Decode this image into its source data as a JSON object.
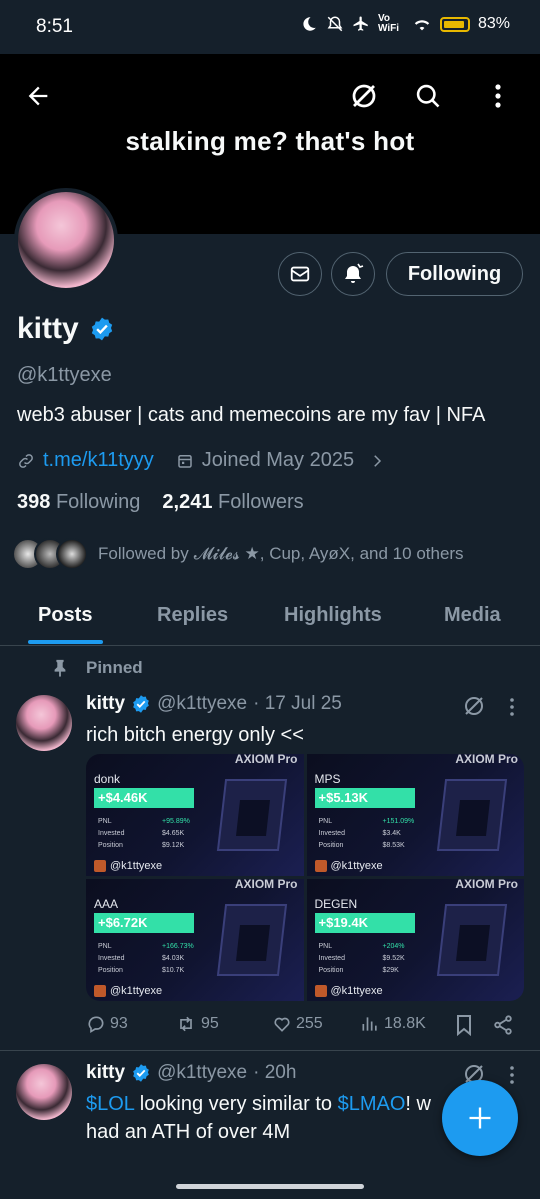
{
  "status_bar": {
    "time": "8:51",
    "net_label": "Vo WiFi",
    "battery": "83%"
  },
  "header": {
    "banner_text": "stalking me? that's hot"
  },
  "profile": {
    "name": "kitty",
    "handle": "@k1ttyexe",
    "bio": "web3 abuser | cats and memecoins are my fav | NFA",
    "link": "t.me/k11tyyy",
    "joined": "Joined May 2025",
    "following_count": "398",
    "following_label": "Following",
    "followers_count": "2,241",
    "followers_label": "Followers",
    "followed_by_prefix": "Followed by",
    "followed_by_names": "𝓜𝓲𝓵𝓮𝓼 ★, Cup, AyøX, and 10 others",
    "follow_button": "Following"
  },
  "tabs": [
    {
      "label": "Posts"
    },
    {
      "label": "Replies"
    },
    {
      "label": "Highlights"
    },
    {
      "label": "Media"
    }
  ],
  "posts": [
    {
      "pinned_label": "Pinned",
      "name": "kitty",
      "handle": "@k1ttyexe",
      "time": "· 17 Jul 25",
      "text": "rich bitch energy only <<",
      "cards": [
        {
          "brand": "AXIOM Pro",
          "ticker": "donk",
          "gain": "+$4.46K",
          "pnl": "+95.89%",
          "invested": "$4.65K",
          "position": "$9.12K",
          "tag": "@k1ttyexe"
        },
        {
          "brand": "AXIOM Pro",
          "ticker": "MPS",
          "gain": "+$5.13K",
          "pnl": "+151.09%",
          "invested": "$3.4K",
          "position": "$8.53K",
          "tag": "@k1ttyexe"
        },
        {
          "brand": "AXIOM Pro",
          "ticker": "AAA",
          "gain": "+$6.72K",
          "pnl": "+166.73%",
          "invested": "$4.03K",
          "position": "$10.7K",
          "tag": "@k1ttyexe"
        },
        {
          "brand": "AXIOM Pro",
          "ticker": "DEGEN",
          "gain": "+$19.4K",
          "pnl": "+204%",
          "invested": "$9.52K",
          "position": "$29K",
          "tag": "@k1ttyexe"
        }
      ],
      "card_row_labels": {
        "pnl": "PNL",
        "invested": "Invested",
        "position": "Position"
      },
      "replies": "93",
      "reposts": "95",
      "likes": "255",
      "views": "18.8K"
    },
    {
      "name": "kitty",
      "handle": "@k1ttyexe",
      "time": "· 20h",
      "text_cash1": "$LOL",
      "text_mid": " looking very similar to ",
      "text_cash2": "$LMAO",
      "text_tail": "! w",
      "text_line2": "had an ATH of over 4M"
    }
  ],
  "colors": {
    "accent": "#1d9bf0",
    "background": "#15202b",
    "gain_green": "#33e0a8"
  }
}
